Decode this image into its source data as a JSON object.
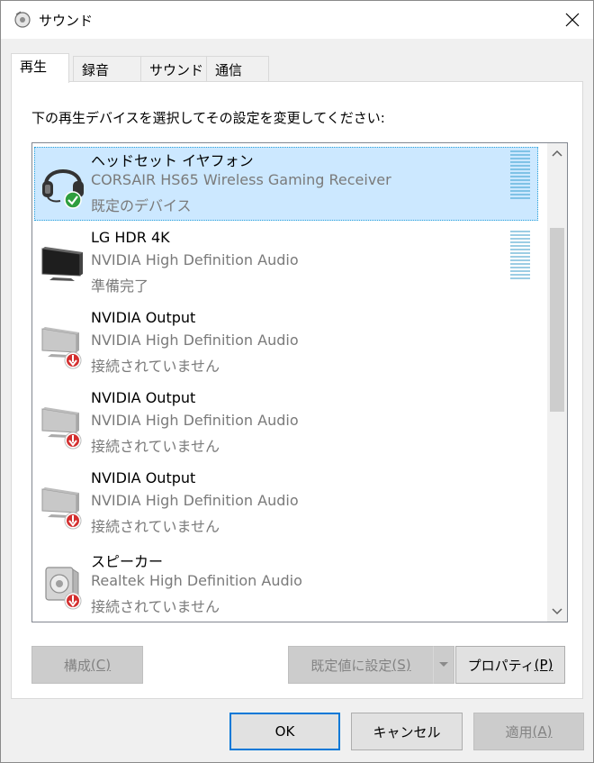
{
  "window": {
    "title": "サウンド"
  },
  "tabs": [
    {
      "label": "再生",
      "active": true
    },
    {
      "label": "録音",
      "active": false
    },
    {
      "label": "サウンド",
      "active": false
    },
    {
      "label": "通信",
      "active": false
    }
  ],
  "instruction": "下の再生デバイスを選択してその設定を変更してください:",
  "devices": [
    {
      "name": "ヘッドセット イヤフォン",
      "driver": "CORSAIR HS65 Wireless Gaming Receiver",
      "status": "既定のデバイス",
      "icon": "headset-icon",
      "badge": "check-badge-icon",
      "selected": true
    },
    {
      "name": "LG HDR 4K",
      "driver": "NVIDIA High Definition Audio",
      "status": "準備完了",
      "icon": "monitor-icon",
      "badge": null,
      "selected": false
    },
    {
      "name": "NVIDIA Output",
      "driver": "NVIDIA High Definition Audio",
      "status": "接続されていません",
      "icon": "monitor-icon",
      "badge": "disconnected-badge-icon",
      "selected": false
    },
    {
      "name": "NVIDIA Output",
      "driver": "NVIDIA High Definition Audio",
      "status": "接続されていません",
      "icon": "monitor-icon",
      "badge": "disconnected-badge-icon",
      "selected": false
    },
    {
      "name": "NVIDIA Output",
      "driver": "NVIDIA High Definition Audio",
      "status": "接続されていません",
      "icon": "monitor-icon",
      "badge": "disconnected-badge-icon",
      "selected": false
    },
    {
      "name": "スピーカー",
      "driver": "Realtek High Definition Audio",
      "status": "接続されていません",
      "icon": "speaker-icon",
      "badge": "disconnected-badge-icon",
      "selected": false
    }
  ],
  "buttons": {
    "configure": {
      "label": "構成",
      "accel": "(C)",
      "enabled": false
    },
    "set_default": {
      "label": "既定値に設定",
      "accel": "(S)",
      "enabled": false
    },
    "properties": {
      "label": "プロパティ",
      "accel": "(P)",
      "enabled": true
    },
    "ok": {
      "label": "OK",
      "enabled": true
    },
    "cancel": {
      "label": "キャンセル",
      "enabled": true
    },
    "apply": {
      "label": "適用",
      "accel": "(A)",
      "enabled": false
    }
  },
  "colors": {
    "selection_bg": "#cce8ff",
    "selection_border": "#26a0da",
    "default_button_border": "#0078d7",
    "check_badge": "#2e9e3e",
    "disconnected_badge": "#d32f2f"
  }
}
